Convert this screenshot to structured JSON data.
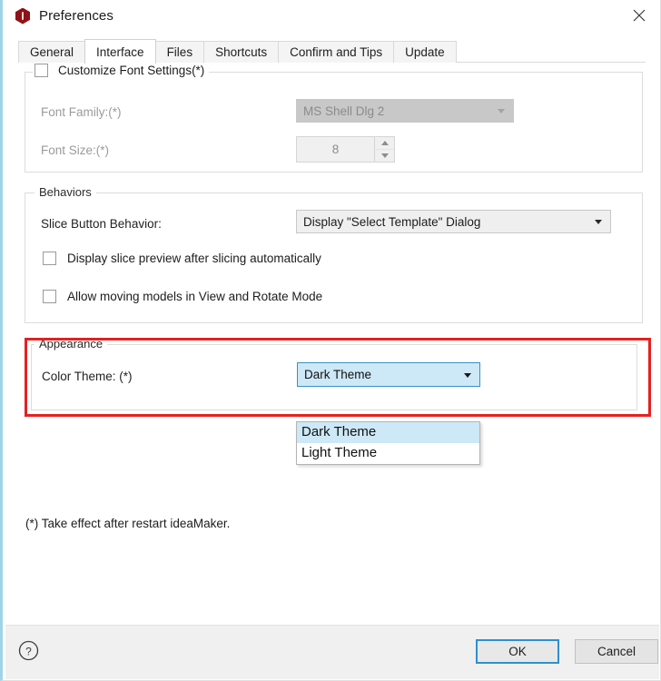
{
  "window": {
    "title": "Preferences",
    "app_icon": "info-hexagon-icon",
    "close_icon": "close-icon",
    "accent_color": "#8e1216",
    "highlight_color": "#e62020",
    "focus_color": "#2f8fd0"
  },
  "tabs": [
    {
      "label": "General",
      "active": false
    },
    {
      "label": "Interface",
      "active": true
    },
    {
      "label": "Files",
      "active": false
    },
    {
      "label": "Shortcuts",
      "active": false
    },
    {
      "label": "Confirm and Tips",
      "active": false
    },
    {
      "label": "Update",
      "active": false
    }
  ],
  "font_group": {
    "legend": "Customize Font Settings(*)",
    "checkbox_checked": false,
    "font_family": {
      "label": "Font Family:(*)",
      "value": "MS Shell Dlg 2",
      "disabled": true
    },
    "font_size": {
      "label": "Font Size:(*)",
      "value": "8",
      "disabled": true
    }
  },
  "behaviors_group": {
    "legend": "Behaviors",
    "slice_button": {
      "label": "Slice Button Behavior:",
      "value": "Display \"Select Template\" Dialog"
    },
    "checkboxes": [
      {
        "label": "Display slice preview after slicing automatically",
        "checked": false
      },
      {
        "label": "Allow moving models in View and Rotate Mode",
        "checked": false
      }
    ]
  },
  "appearance_group": {
    "legend": "Appearance",
    "color_theme": {
      "label": "Color Theme: (*)",
      "value": "Dark Theme",
      "expanded": true,
      "options": [
        {
          "label": "Dark Theme",
          "selected": true
        },
        {
          "label": "Light Theme",
          "selected": false
        }
      ]
    }
  },
  "footnote": "(*) Take effect after restart ideaMaker.",
  "footer": {
    "help_icon": "help-circle-icon",
    "ok_label": "OK",
    "cancel_label": "Cancel"
  }
}
